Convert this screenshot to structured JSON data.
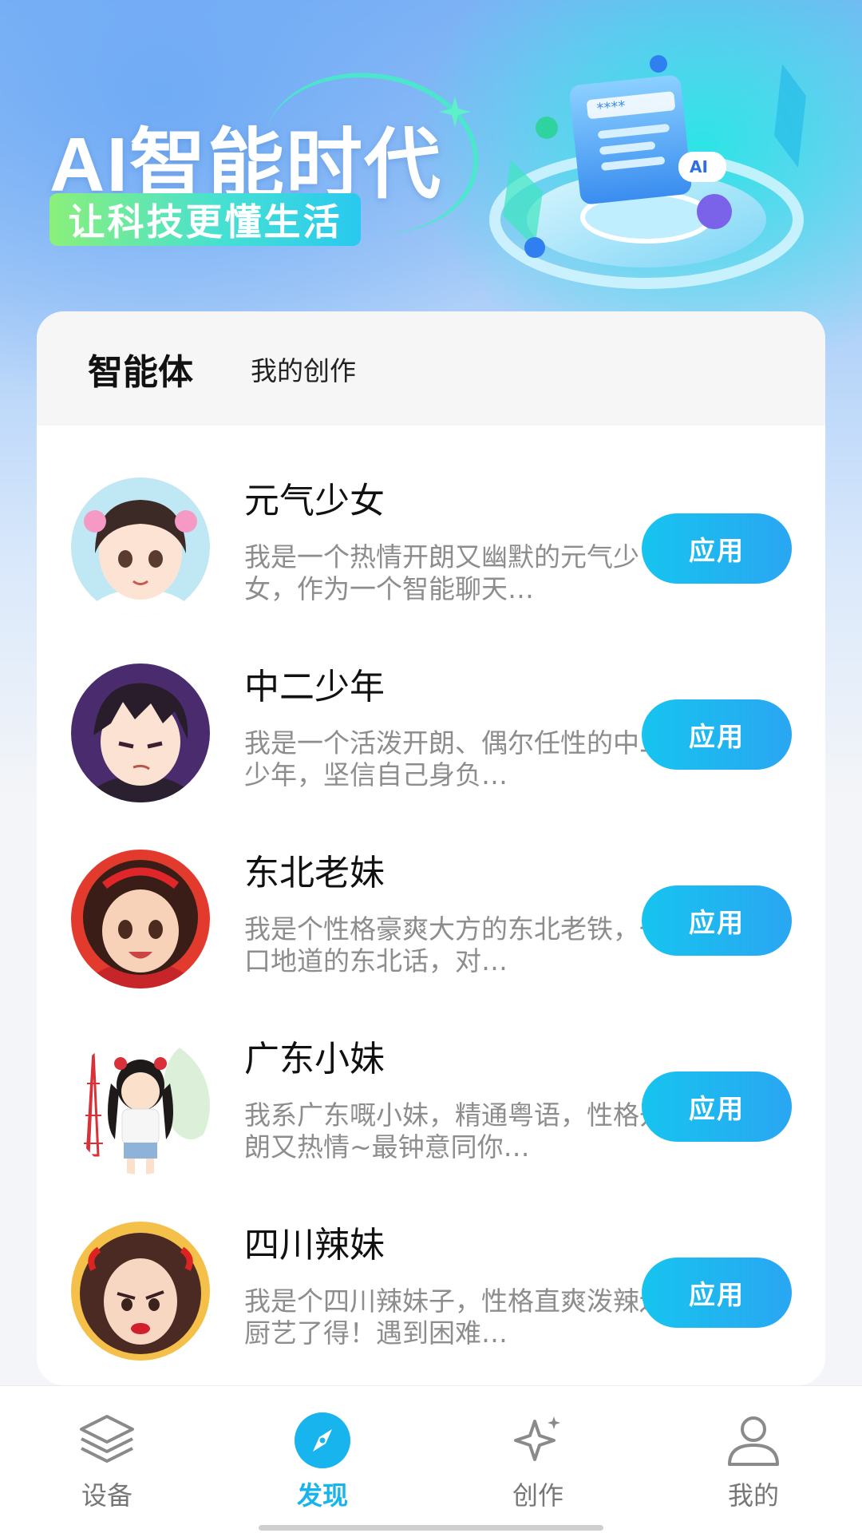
{
  "hero": {
    "title": "AI智能时代",
    "subtitle": "让科技更懂生活",
    "art_badge": "AI",
    "art_stars": "****"
  },
  "tabs": [
    {
      "label": "智能体",
      "active": true
    },
    {
      "label": "我的创作",
      "active": false
    }
  ],
  "agents": [
    {
      "name": "元气少女",
      "description": "我是一个热情开朗又幽默的元气少女，作为一个智能聊天…",
      "button": "应用",
      "avatar_icon": "girl-avatar"
    },
    {
      "name": "中二少年",
      "description": "我是一个活泼开朗、偶尔任性的中二少年，坚信自己身负…",
      "button": "应用",
      "avatar_icon": "boy-avatar"
    },
    {
      "name": "东北老妹",
      "description": "我是个性格豪爽大方的东北老铁，一口地道的东北话，对…",
      "button": "应用",
      "avatar_icon": "curly-girl-avatar"
    },
    {
      "name": "广东小妹",
      "description": "我系广东嘅小妹，精通粤语，性格开朗又热情~最钟意同你…",
      "button": "应用",
      "avatar_icon": "canton-girl-avatar"
    },
    {
      "name": "四川辣妹",
      "description": "我是个四川辣妹子，性格直爽泼辣还厨艺了得！遇到困难…",
      "button": "应用",
      "avatar_icon": "sichuan-girl-avatar"
    }
  ],
  "bottom_nav": [
    {
      "label": "设备",
      "icon": "layers-icon",
      "active": false
    },
    {
      "label": "发现",
      "icon": "compass-icon",
      "active": true
    },
    {
      "label": "创作",
      "icon": "sparkle-icon",
      "active": false
    },
    {
      "label": "我的",
      "icon": "user-icon",
      "active": false
    }
  ],
  "colors": {
    "accent": "#17b4ee",
    "button_start": "#16c4ef",
    "button_end": "#2aa6f2",
    "description": "#8d8d8d"
  }
}
